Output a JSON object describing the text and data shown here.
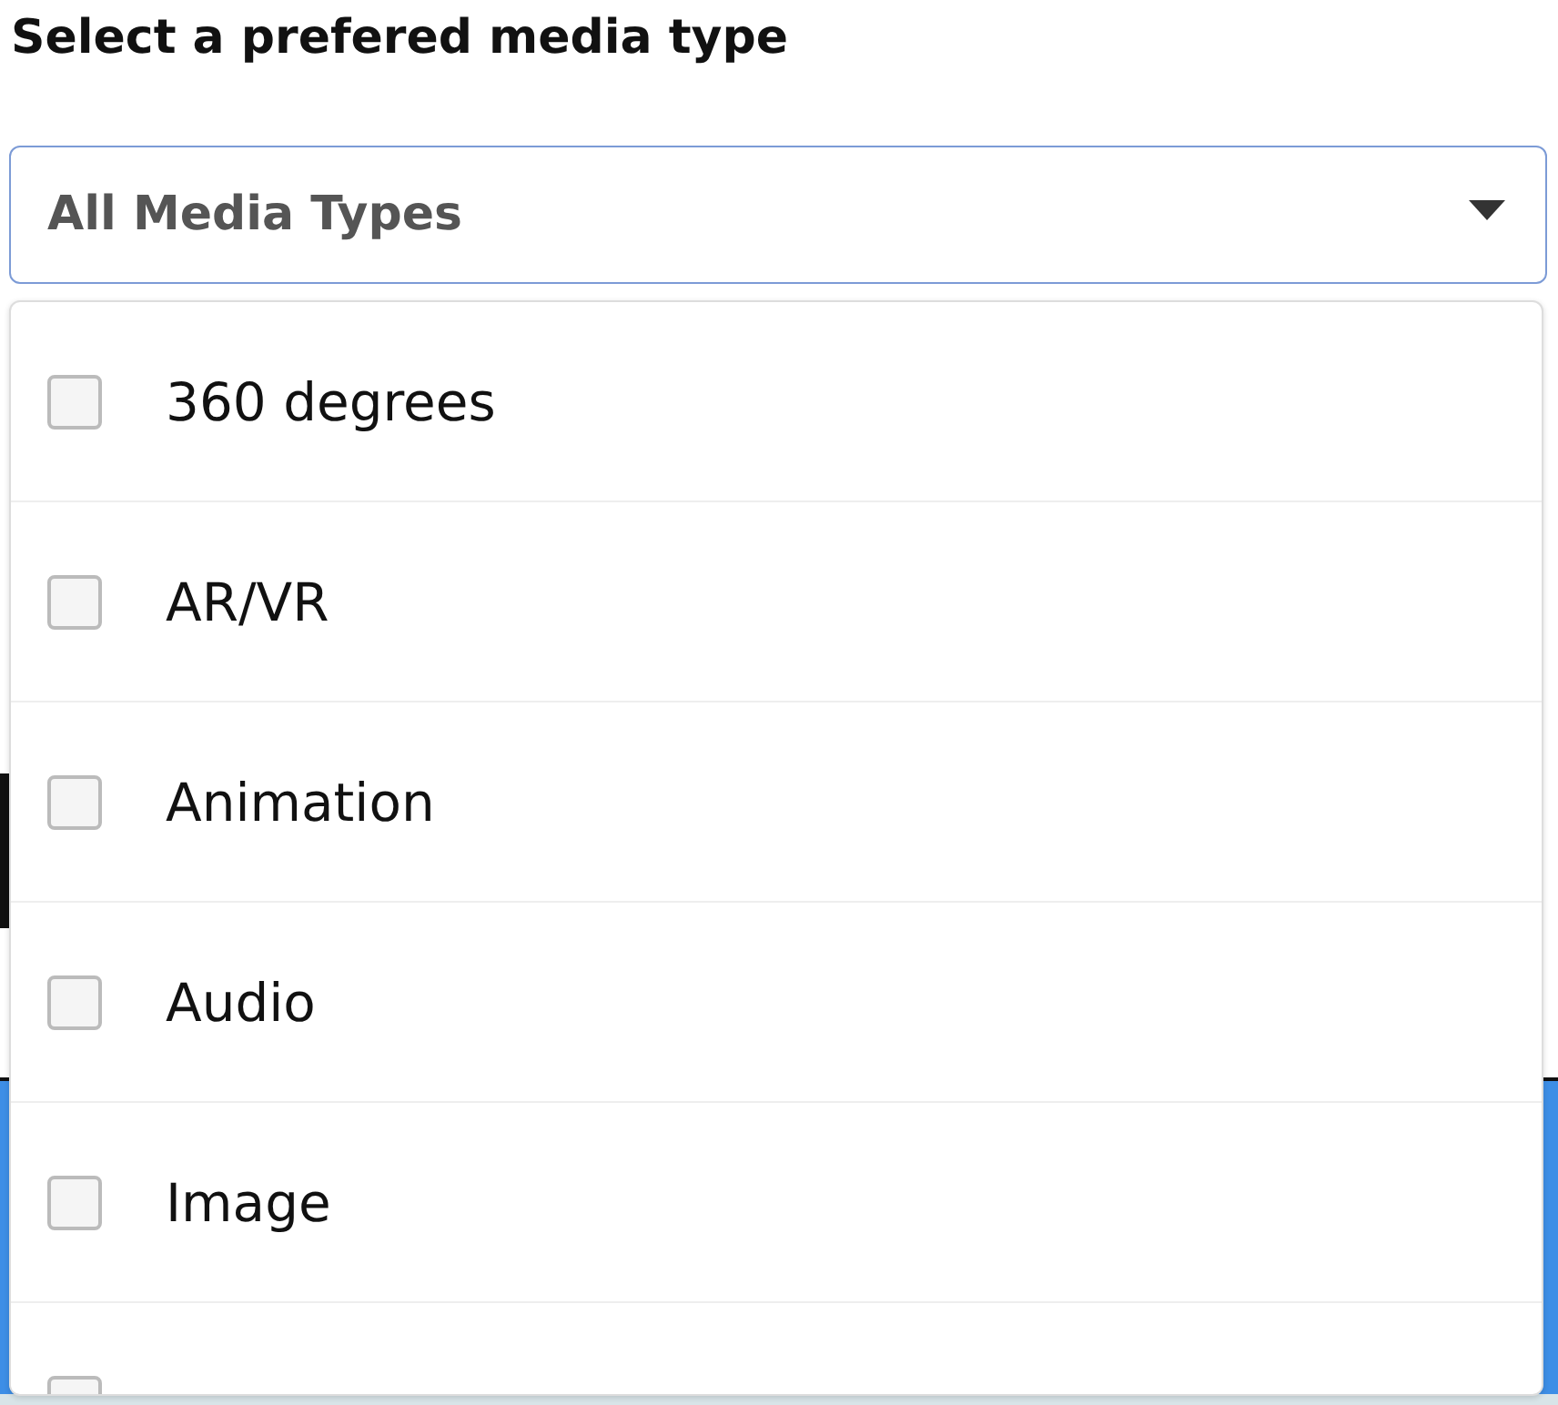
{
  "label": "Select a prefered media type",
  "select": {
    "value": "All Media Types",
    "expanded": true
  },
  "options": [
    {
      "label": "360 degrees",
      "checked": false
    },
    {
      "label": "AR/VR",
      "checked": false
    },
    {
      "label": "Animation",
      "checked": false
    },
    {
      "label": "Audio",
      "checked": false
    },
    {
      "label": "Image",
      "checked": false
    },
    {
      "checked": false
    }
  ]
}
